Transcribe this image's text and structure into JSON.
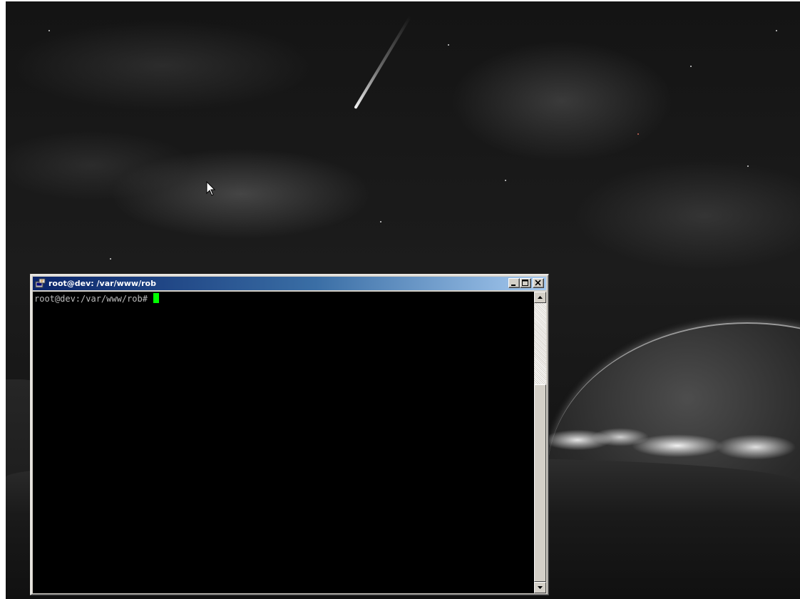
{
  "terminal": {
    "title": "root@dev: /var/www/rob",
    "prompt": "root@dev:/var/www/rob#",
    "cursor_color": "#00ff00",
    "title_icon": "putty-icon",
    "scrollbar_position": 1.0
  },
  "window_controls": {
    "minimize_icon": "minimize-icon",
    "maximize_icon": "maximize-icon",
    "close_icon": "close-icon"
  },
  "desktop": {
    "wallpaper": "night-sky-planet",
    "pointer_icon": "arrow-cursor-icon"
  },
  "colors": {
    "titlebar_start": "#0a246a",
    "titlebar_end": "#a6caf0",
    "terminal_bg": "#000000",
    "prompt_text": "#bbbbbb"
  }
}
